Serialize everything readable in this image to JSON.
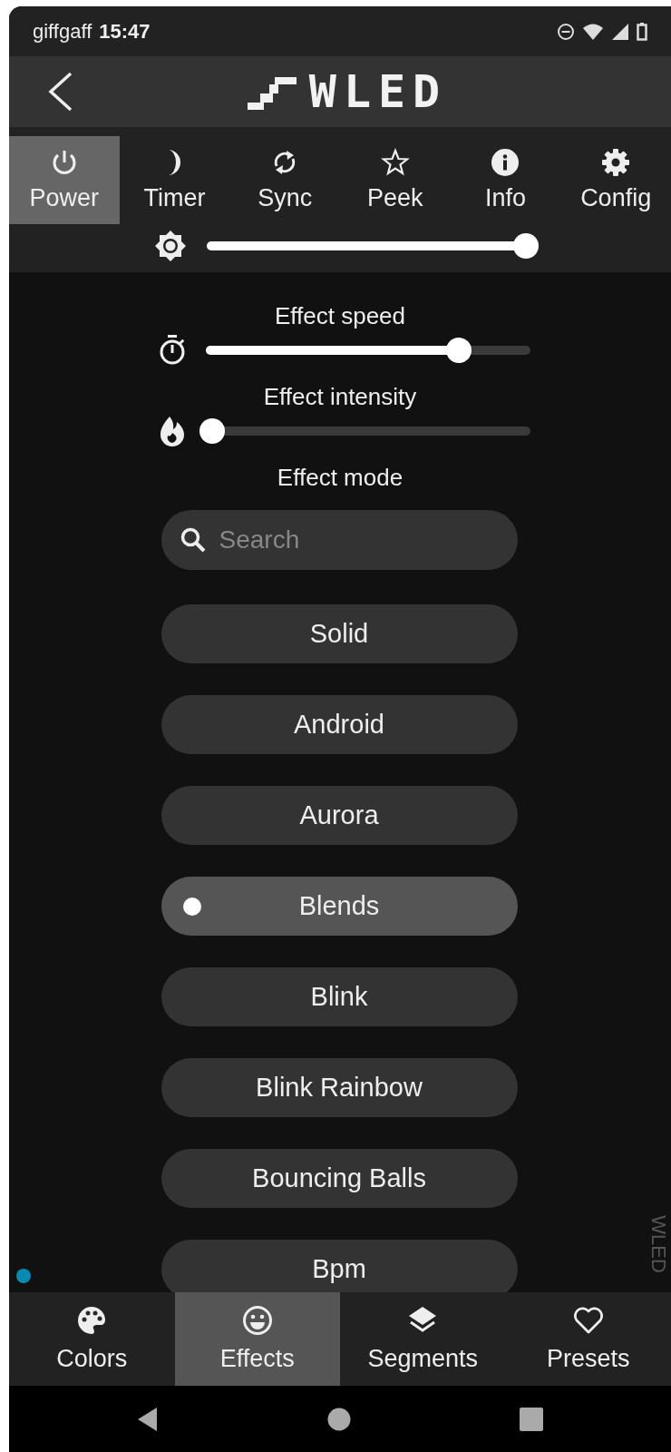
{
  "status_bar": {
    "carrier": "giffgaff",
    "time": "15:47"
  },
  "header": {
    "logo": "WLED"
  },
  "top_tabs": [
    {
      "label": "Power",
      "kind": "power",
      "selected": true
    },
    {
      "label": "Timer",
      "kind": "timer",
      "selected": false
    },
    {
      "label": "Sync",
      "kind": "sync",
      "selected": false
    },
    {
      "label": "Peek",
      "kind": "peek",
      "selected": false
    },
    {
      "label": "Info",
      "kind": "info",
      "selected": false
    },
    {
      "label": "Config",
      "kind": "config",
      "selected": false
    }
  ],
  "brightness": {
    "level": 1.0
  },
  "sliders": [
    {
      "label": "Effect speed",
      "kind": "speed",
      "level": 0.78
    },
    {
      "label": "Effect intensity",
      "kind": "intensity",
      "level": 0.02
    }
  ],
  "effect_mode": {
    "label": "Effect mode",
    "search": {
      "placeholder": "Search"
    },
    "effects": [
      {
        "label": "Solid",
        "selected": false
      },
      {
        "label": "Android",
        "selected": false
      },
      {
        "label": "Aurora",
        "selected": false
      },
      {
        "label": "Blends",
        "selected": true
      },
      {
        "label": "Blink",
        "selected": false
      },
      {
        "label": "Blink Rainbow",
        "selected": false
      },
      {
        "label": "Bouncing Balls",
        "selected": false
      },
      {
        "label": "Bpm",
        "selected": false
      }
    ]
  },
  "side_label": "WLED",
  "bottom_tabs": [
    {
      "label": "Colors",
      "kind": "colors",
      "selected": false
    },
    {
      "label": "Effects",
      "kind": "effects",
      "selected": true
    },
    {
      "label": "Segments",
      "kind": "segments",
      "selected": false
    },
    {
      "label": "Presets",
      "kind": "presets",
      "selected": false
    }
  ]
}
